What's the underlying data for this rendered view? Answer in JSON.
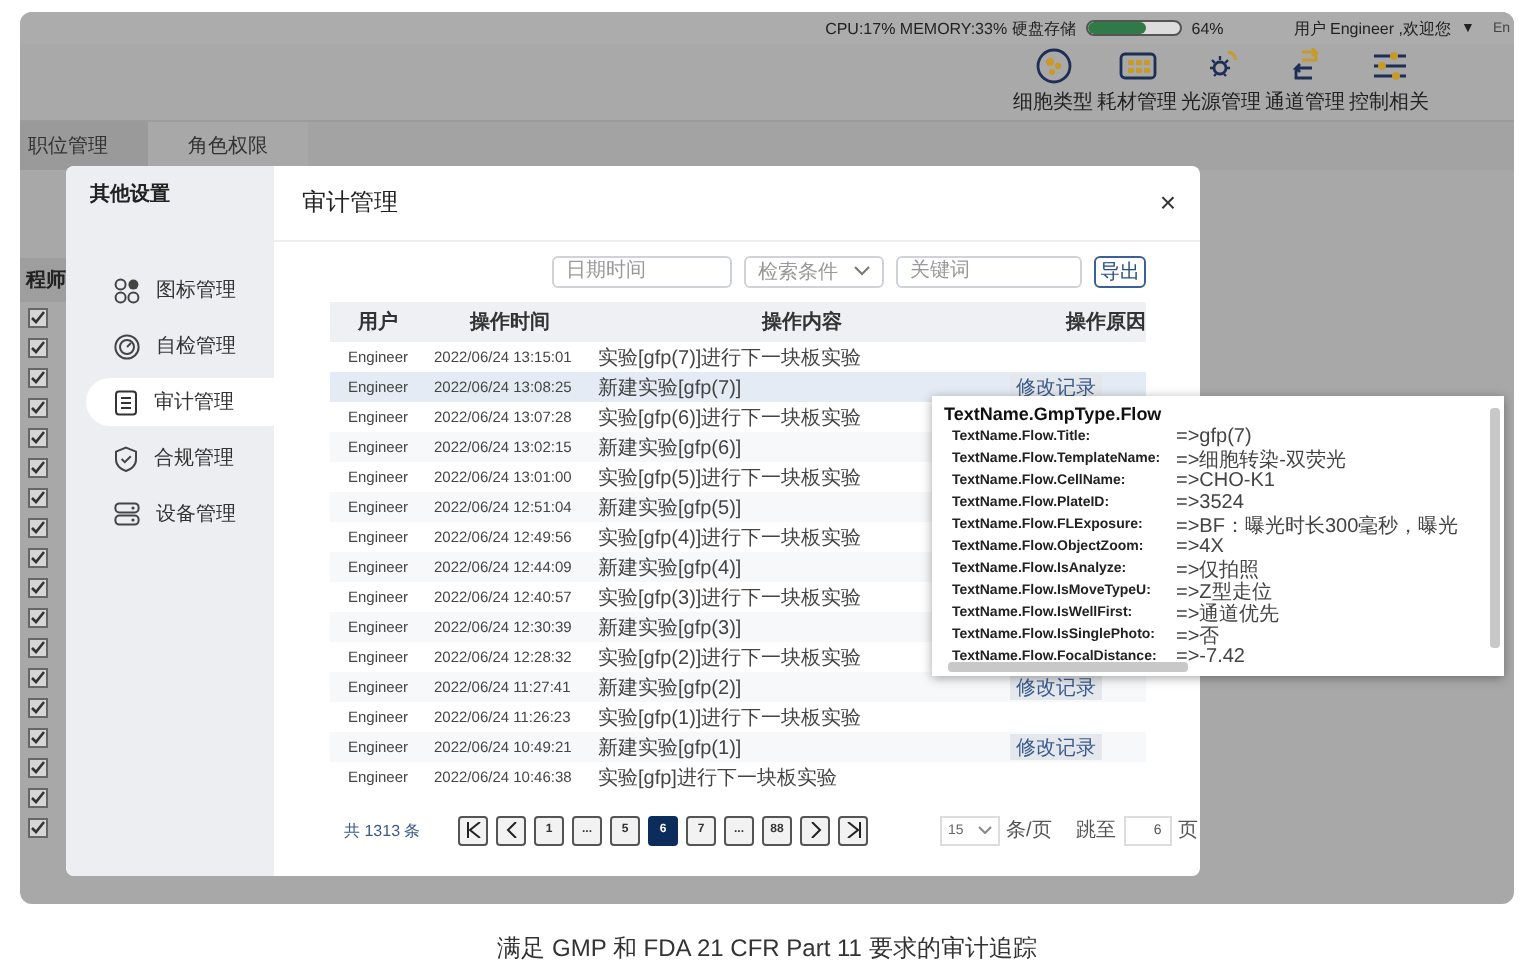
{
  "status_bar": {
    "system": "CPU:17% MEMORY:33% 硬盘存储",
    "disk": {
      "level": 0.64,
      "reading": "64%"
    },
    "user": "用户 Engineer ,欢迎您",
    "user_caret": "▼",
    "edge_text": "En"
  },
  "toolbar": [
    {
      "label": "细胞类型"
    },
    {
      "label": "耗材管理"
    },
    {
      "label": "光源管理"
    },
    {
      "label": "通道管理"
    },
    {
      "label": "控制相关"
    }
  ],
  "tabs": [
    {
      "label": "职位管理",
      "selected": false
    },
    {
      "label": "角色权限",
      "selected": true
    }
  ],
  "permission_column": {
    "header": "程师",
    "checkboxes": [
      {
        "checked": true
      },
      {
        "checked": true
      },
      {
        "checked": true
      },
      {
        "checked": true
      },
      {
        "checked": true
      },
      {
        "checked": true
      },
      {
        "checked": true
      },
      {
        "checked": true
      },
      {
        "checked": true
      },
      {
        "checked": true
      },
      {
        "checked": true
      },
      {
        "checked": true
      },
      {
        "checked": true
      },
      {
        "checked": true
      },
      {
        "checked": true
      },
      {
        "checked": true
      },
      {
        "checked": true
      },
      {
        "checked": true
      }
    ]
  },
  "dialog": {
    "sidebar_title": "其他设置",
    "menu": [
      {
        "label": "图标管理",
        "selected": false
      },
      {
        "label": "自检管理",
        "selected": false
      },
      {
        "label": "审计管理",
        "selected": true
      },
      {
        "label": "合规管理",
        "selected": false
      },
      {
        "label": "设备管理",
        "selected": false
      }
    ],
    "title": "审计管理",
    "close": "×",
    "filters": {
      "date_placeholder": "日期时间",
      "condition_placeholder": "检索条件",
      "keyword_placeholder": "关键词",
      "export": "导出"
    },
    "table": {
      "columns": [
        "用户",
        "操作时间",
        "操作内容",
        "操作原因"
      ],
      "rows": [
        {
          "user": "Engineer",
          "time": "2022/06/24 13:15:01",
          "content": "实验[gfp(7)]进行下一块板实验",
          "selected": false
        },
        {
          "user": "Engineer",
          "time": "2022/06/24 13:08:25",
          "content": "新建实验[gfp(7)]",
          "reason": "修改记录",
          "selected": true
        },
        {
          "user": "Engineer",
          "time": "2022/06/24 13:07:28",
          "content": "实验[gfp(6)]进行下一块板实验",
          "selected": false
        },
        {
          "user": "Engineer",
          "time": "2022/06/24 13:02:15",
          "content": "新建实验[gfp(6)]",
          "selected": false
        },
        {
          "user": "Engineer",
          "time": "2022/06/24 13:01:00",
          "content": "实验[gfp(5)]进行下一块板实验",
          "selected": false
        },
        {
          "user": "Engineer",
          "time": "2022/06/24 12:51:04",
          "content": "新建实验[gfp(5)]",
          "selected": false
        },
        {
          "user": "Engineer",
          "time": "2022/06/24 12:49:56",
          "content": "实验[gfp(4)]进行下一块板实验",
          "selected": false
        },
        {
          "user": "Engineer",
          "time": "2022/06/24 12:44:09",
          "content": "新建实验[gfp(4)]",
          "selected": false
        },
        {
          "user": "Engineer",
          "time": "2022/06/24 12:40:57",
          "content": "实验[gfp(3)]进行下一块板实验",
          "selected": false
        },
        {
          "user": "Engineer",
          "time": "2022/06/24 12:30:39",
          "content": "新建实验[gfp(3)]",
          "selected": false
        },
        {
          "user": "Engineer",
          "time": "2022/06/24 12:28:32",
          "content": "实验[gfp(2)]进行下一块板实验",
          "selected": false
        },
        {
          "user": "Engineer",
          "time": "2022/06/24 11:27:41",
          "content": "新建实验[gfp(2)]",
          "reason": "修改记录",
          "selected": false
        },
        {
          "user": "Engineer",
          "time": "2022/06/24 11:26:23",
          "content": "实验[gfp(1)]进行下一块板实验",
          "selected": false
        },
        {
          "user": "Engineer",
          "time": "2022/06/24 10:49:21",
          "content": "新建实验[gfp(1)]",
          "reason": "修改记录",
          "selected": false
        },
        {
          "user": "Engineer",
          "time": "2022/06/24 10:46:38",
          "content": "实验[gfp]进行下一块板实验",
          "selected": false
        }
      ]
    },
    "pagination": {
      "total": "共 1313 条",
      "pages": [
        {
          "label": "1",
          "selected": false
        },
        {
          "label": "...",
          "selected": false
        },
        {
          "label": "5",
          "selected": false
        },
        {
          "label": "6",
          "selected": true
        },
        {
          "label": "7",
          "selected": false
        },
        {
          "label": "...",
          "selected": false
        },
        {
          "label": "88",
          "selected": false
        }
      ],
      "page_size": "15",
      "per_page": "条/页",
      "jump_label": "跳至",
      "jump_value": "6",
      "page_unit": "页"
    }
  },
  "tooltip": {
    "title": "TextName.GmpType.Flow",
    "lines": [
      {
        "label": "TextName.Flow.Title:",
        "value": "=>gfp(7)"
      },
      {
        "label": "TextName.Flow.TemplateName:",
        "value": "=>细胞转染-双荧光"
      },
      {
        "label": "TextName.Flow.CellName:",
        "value": "=>CHO-K1"
      },
      {
        "label": "TextName.Flow.PlateID:",
        "value": "=>3524"
      },
      {
        "label": "TextName.Flow.FLExposure:",
        "value": "=>BF：曝光时长300毫秒，曝光"
      },
      {
        "label": "TextName.Flow.ObjectZoom:",
        "value": "=>4X"
      },
      {
        "label": "TextName.Flow.IsAnalyze:",
        "value": "=>仅拍照"
      },
      {
        "label": "TextName.Flow.IsMoveTypeU:",
        "value": "=>Z型走位"
      },
      {
        "label": "TextName.Flow.IsWellFirst:",
        "value": "=>通道优先"
      },
      {
        "label": "TextName.Flow.IsSinglePhoto:",
        "value": "=>否"
      },
      {
        "label": "TextName.Flow.FocalDistance:",
        "value": "=>-7.42"
      }
    ]
  },
  "caption": "满足 GMP 和 FDA 21 CFR Part 11 要求的审计追踪"
}
